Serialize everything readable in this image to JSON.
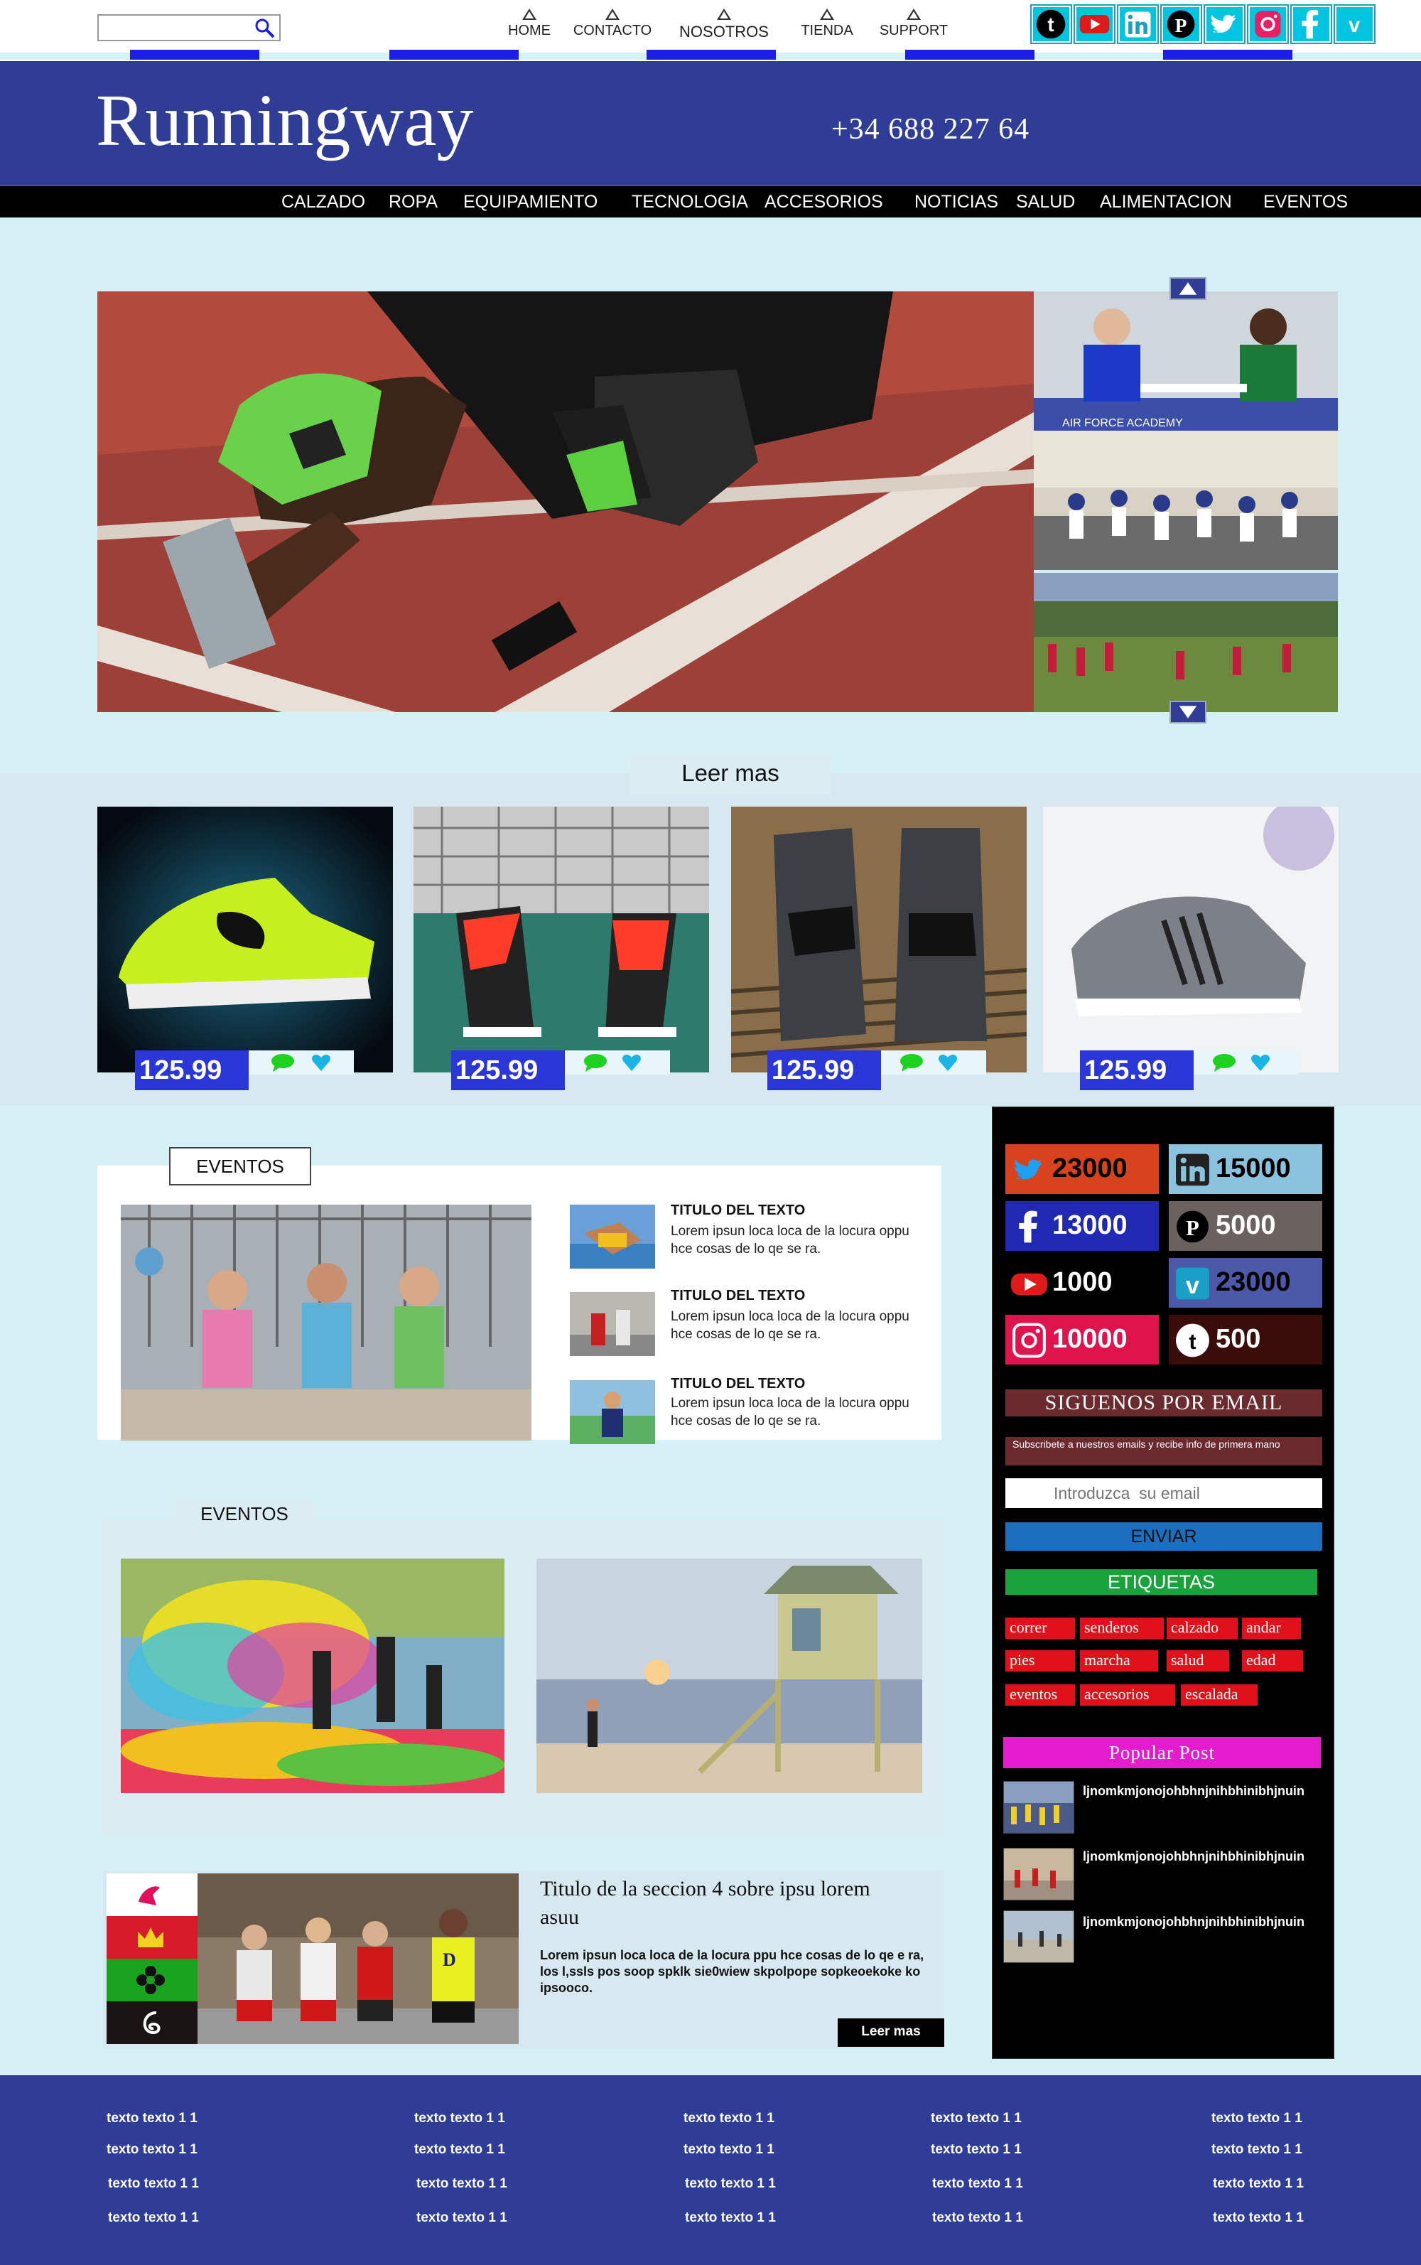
{
  "topbar": {
    "search_placeholder": "",
    "nav": [
      "HOME",
      "CONTACTO",
      "NOSOTROS",
      "TIENDA",
      "SUPPORT"
    ],
    "social_icons": [
      "tumblr-icon",
      "youtube-icon",
      "linkedin-icon",
      "pinterest-icon",
      "twitter-icon",
      "instagram-icon",
      "facebook-icon",
      "vimeo-icon"
    ]
  },
  "header": {
    "logo": "Runningway",
    "phone": "+34 688 227 64"
  },
  "categories": [
    "CALZADO",
    "ROPA",
    "EQUIPAMIENTO",
    "TECNOLOGIA",
    "ACCESORIOS",
    "NOTICIAS",
    "SALUD",
    "ALIMENTACION",
    "EVENTOS"
  ],
  "hero": {
    "read_more": "Leer mas"
  },
  "products": [
    {
      "price": "125.99"
    },
    {
      "price": "125.99"
    },
    {
      "price": "125.99"
    },
    {
      "price": "125.99"
    }
  ],
  "events1": {
    "tab": "EVENTOS",
    "items": [
      {
        "title": "TITULO DEL TEXTO",
        "text": "Lorem ipsun loca loca de la locura oppu hce cosas de lo qe se ra."
      },
      {
        "title": "TITULO DEL TEXTO",
        "text": "Lorem ipsun loca loca de la locura oppu hce cosas de lo qe se ra."
      },
      {
        "title": "TITULO DEL TEXTO",
        "text": "Lorem ipsun loca loca de la locura oppu hce cosas de lo qe se ra."
      }
    ]
  },
  "events2": {
    "tab": "EVENTOS"
  },
  "section4": {
    "title": "Titulo de la seccion 4 sobre ipsu lorem asuu",
    "text": "Lorem ipsun loca loca de la locura ppu hce cosas de lo qe e ra, los l,ssls pos soop spklk sie0wiew skpolpope sopkeoekoke ko ipsooco.",
    "button": "Leer mas"
  },
  "sidebar": {
    "stats": [
      {
        "network": "twitter",
        "count": "23000",
        "color": "#d9421f"
      },
      {
        "network": "linkedin",
        "count": "15000",
        "color": "#8bc2de"
      },
      {
        "network": "facebook",
        "count": "13000",
        "color": "#2129b4"
      },
      {
        "network": "pinterest",
        "count": "5000",
        "color": "#6b6260"
      },
      {
        "network": "youtube",
        "count": "1000",
        "color": "#000000"
      },
      {
        "network": "vimeo",
        "count": "23000",
        "color": "#4b59a8"
      },
      {
        "network": "instagram",
        "count": "10000",
        "color": "#e0134d"
      },
      {
        "network": "tumblr",
        "count": "500",
        "color": "#3a0d0b"
      }
    ],
    "follow_title": "SIGUENOS POR EMAIL",
    "subscribe_text": "Subscribete a nuestros  emails y recibe info de primera mano",
    "email_placeholder": "Introduzca  su email",
    "send_button": "ENVIAR",
    "tags_title": "ETIQUETAS",
    "tags": [
      "correr",
      "senderos",
      "calzado",
      "andar",
      "pies",
      "marcha",
      "salud",
      "edad",
      "eventos",
      "accesorios",
      "escalada"
    ],
    "popular_title": "Popular Post",
    "popular_posts": [
      "ljnomkmjonojohbhnjnihbhinibhjnuin",
      "ljnomkmjonojohbhnjnihbhinibhjnuin",
      "ljnomkmjonojohbhnjnihbhinibhjnuin"
    ]
  },
  "footer": {
    "columns": [
      [
        "texto texto 1 1",
        "texto texto 1 1",
        "texto texto 1 1",
        "texto texto 1 1"
      ],
      [
        "texto texto 1 1",
        "texto texto 1 1",
        "texto texto 1 1",
        "texto texto 1 1"
      ],
      [
        "texto texto 1 1",
        "texto texto 1 1",
        "texto texto 1 1",
        "texto texto 1 1"
      ],
      [
        "texto texto 1 1",
        "texto texto 1 1",
        "texto texto 1 1",
        "texto texto 1 1"
      ],
      [
        "texto texto 1 1",
        "texto texto 1 1",
        "texto texto 1 1",
        "texto texto 1 1"
      ]
    ]
  },
  "colors": {
    "brand_blue": "#2f3d96",
    "accent_blue": "#1a1ee6",
    "page_bg": "#d6f1f6"
  }
}
